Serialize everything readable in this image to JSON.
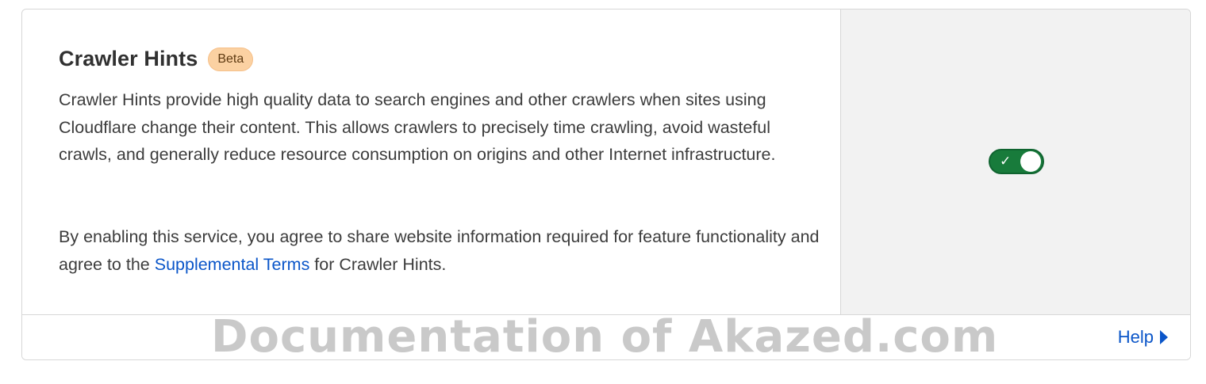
{
  "setting": {
    "title": "Crawler Hints",
    "badge": "Beta",
    "description": "Crawler Hints provide high quality data to search engines and other crawlers when sites using Cloudflare change their content. This allows crawlers to precisely time crawling, avoid wasteful crawls, and generally reduce resource consumption on origins and other Internet infrastructure.",
    "agreement_prefix": "By enabling this service, you agree to share website information required for feature functionality and agree to the ",
    "agreement_link": "Supplemental Terms",
    "agreement_suffix": " for Crawler Hints.",
    "toggle": {
      "state": "on",
      "check_glyph": "✓",
      "color": "#187b3b"
    }
  },
  "footer": {
    "watermark": "Documentation of Akazed.com",
    "help_label": "Help",
    "help_icon": "caret-right-icon"
  },
  "colors": {
    "link": "#0b56c9",
    "badge_bg": "#fbd1a2",
    "toggle_on": "#187b3b"
  }
}
